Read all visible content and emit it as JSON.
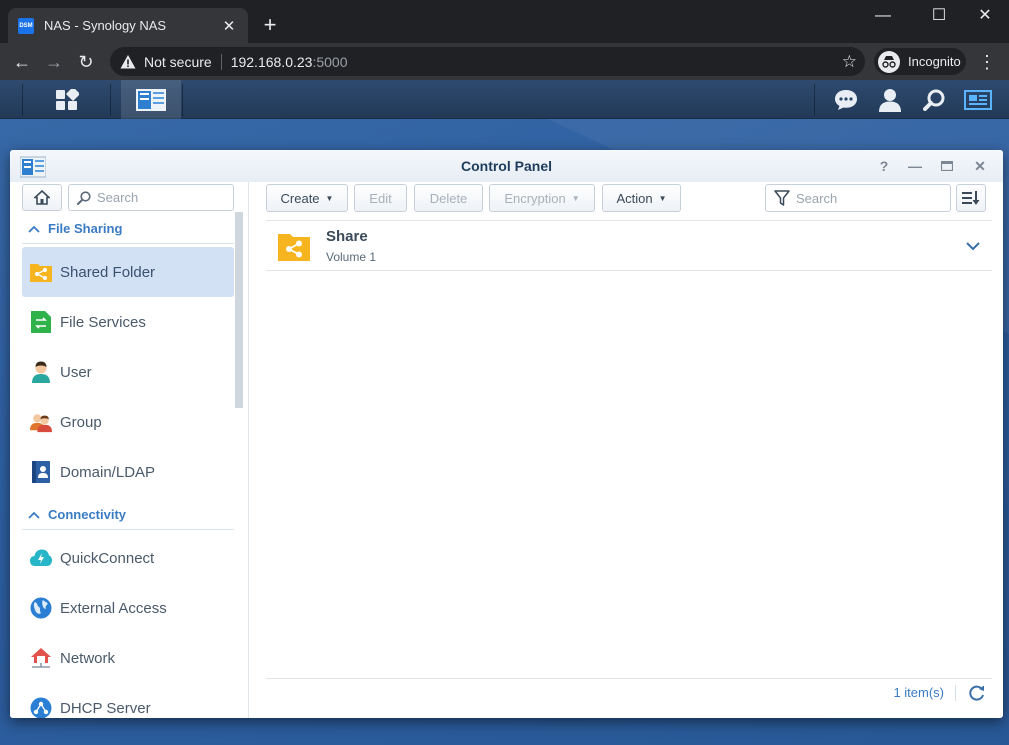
{
  "browser": {
    "tab_title": "NAS - Synology NAS",
    "tab_favicon_text": "DSM",
    "url_warning": "Not secure",
    "url_host": "192.168.0.23",
    "url_port": ":5000",
    "profile_label": "Incognito"
  },
  "window": {
    "title": "Control Panel",
    "help_glyph": "?"
  },
  "sidebar": {
    "search_placeholder": "Search",
    "sections": [
      {
        "label": "File Sharing",
        "items": [
          {
            "label": "Shared Folder",
            "icon": "shared-folder-icon",
            "active": true
          },
          {
            "label": "File Services",
            "icon": "file-services-icon"
          },
          {
            "label": "User",
            "icon": "user-icon"
          },
          {
            "label": "Group",
            "icon": "group-icon"
          },
          {
            "label": "Domain/LDAP",
            "icon": "domain-ldap-icon"
          }
        ]
      },
      {
        "label": "Connectivity",
        "items": [
          {
            "label": "QuickConnect",
            "icon": "quickconnect-icon"
          },
          {
            "label": "External Access",
            "icon": "external-access-icon"
          },
          {
            "label": "Network",
            "icon": "network-icon"
          },
          {
            "label": "DHCP Server",
            "icon": "dhcp-server-icon"
          }
        ]
      }
    ]
  },
  "toolbar": {
    "create": "Create",
    "edit": "Edit",
    "delete": "Delete",
    "encryption": "Encryption",
    "action": "Action",
    "filter_placeholder": "Search"
  },
  "list": {
    "items": [
      {
        "name": "Share",
        "location": "Volume 1"
      }
    ],
    "count": "1 item(s)"
  },
  "colors": {
    "accent": "#3a7cc4",
    "folder": "#f6b51e",
    "active_nav": "#d2e2f4"
  }
}
